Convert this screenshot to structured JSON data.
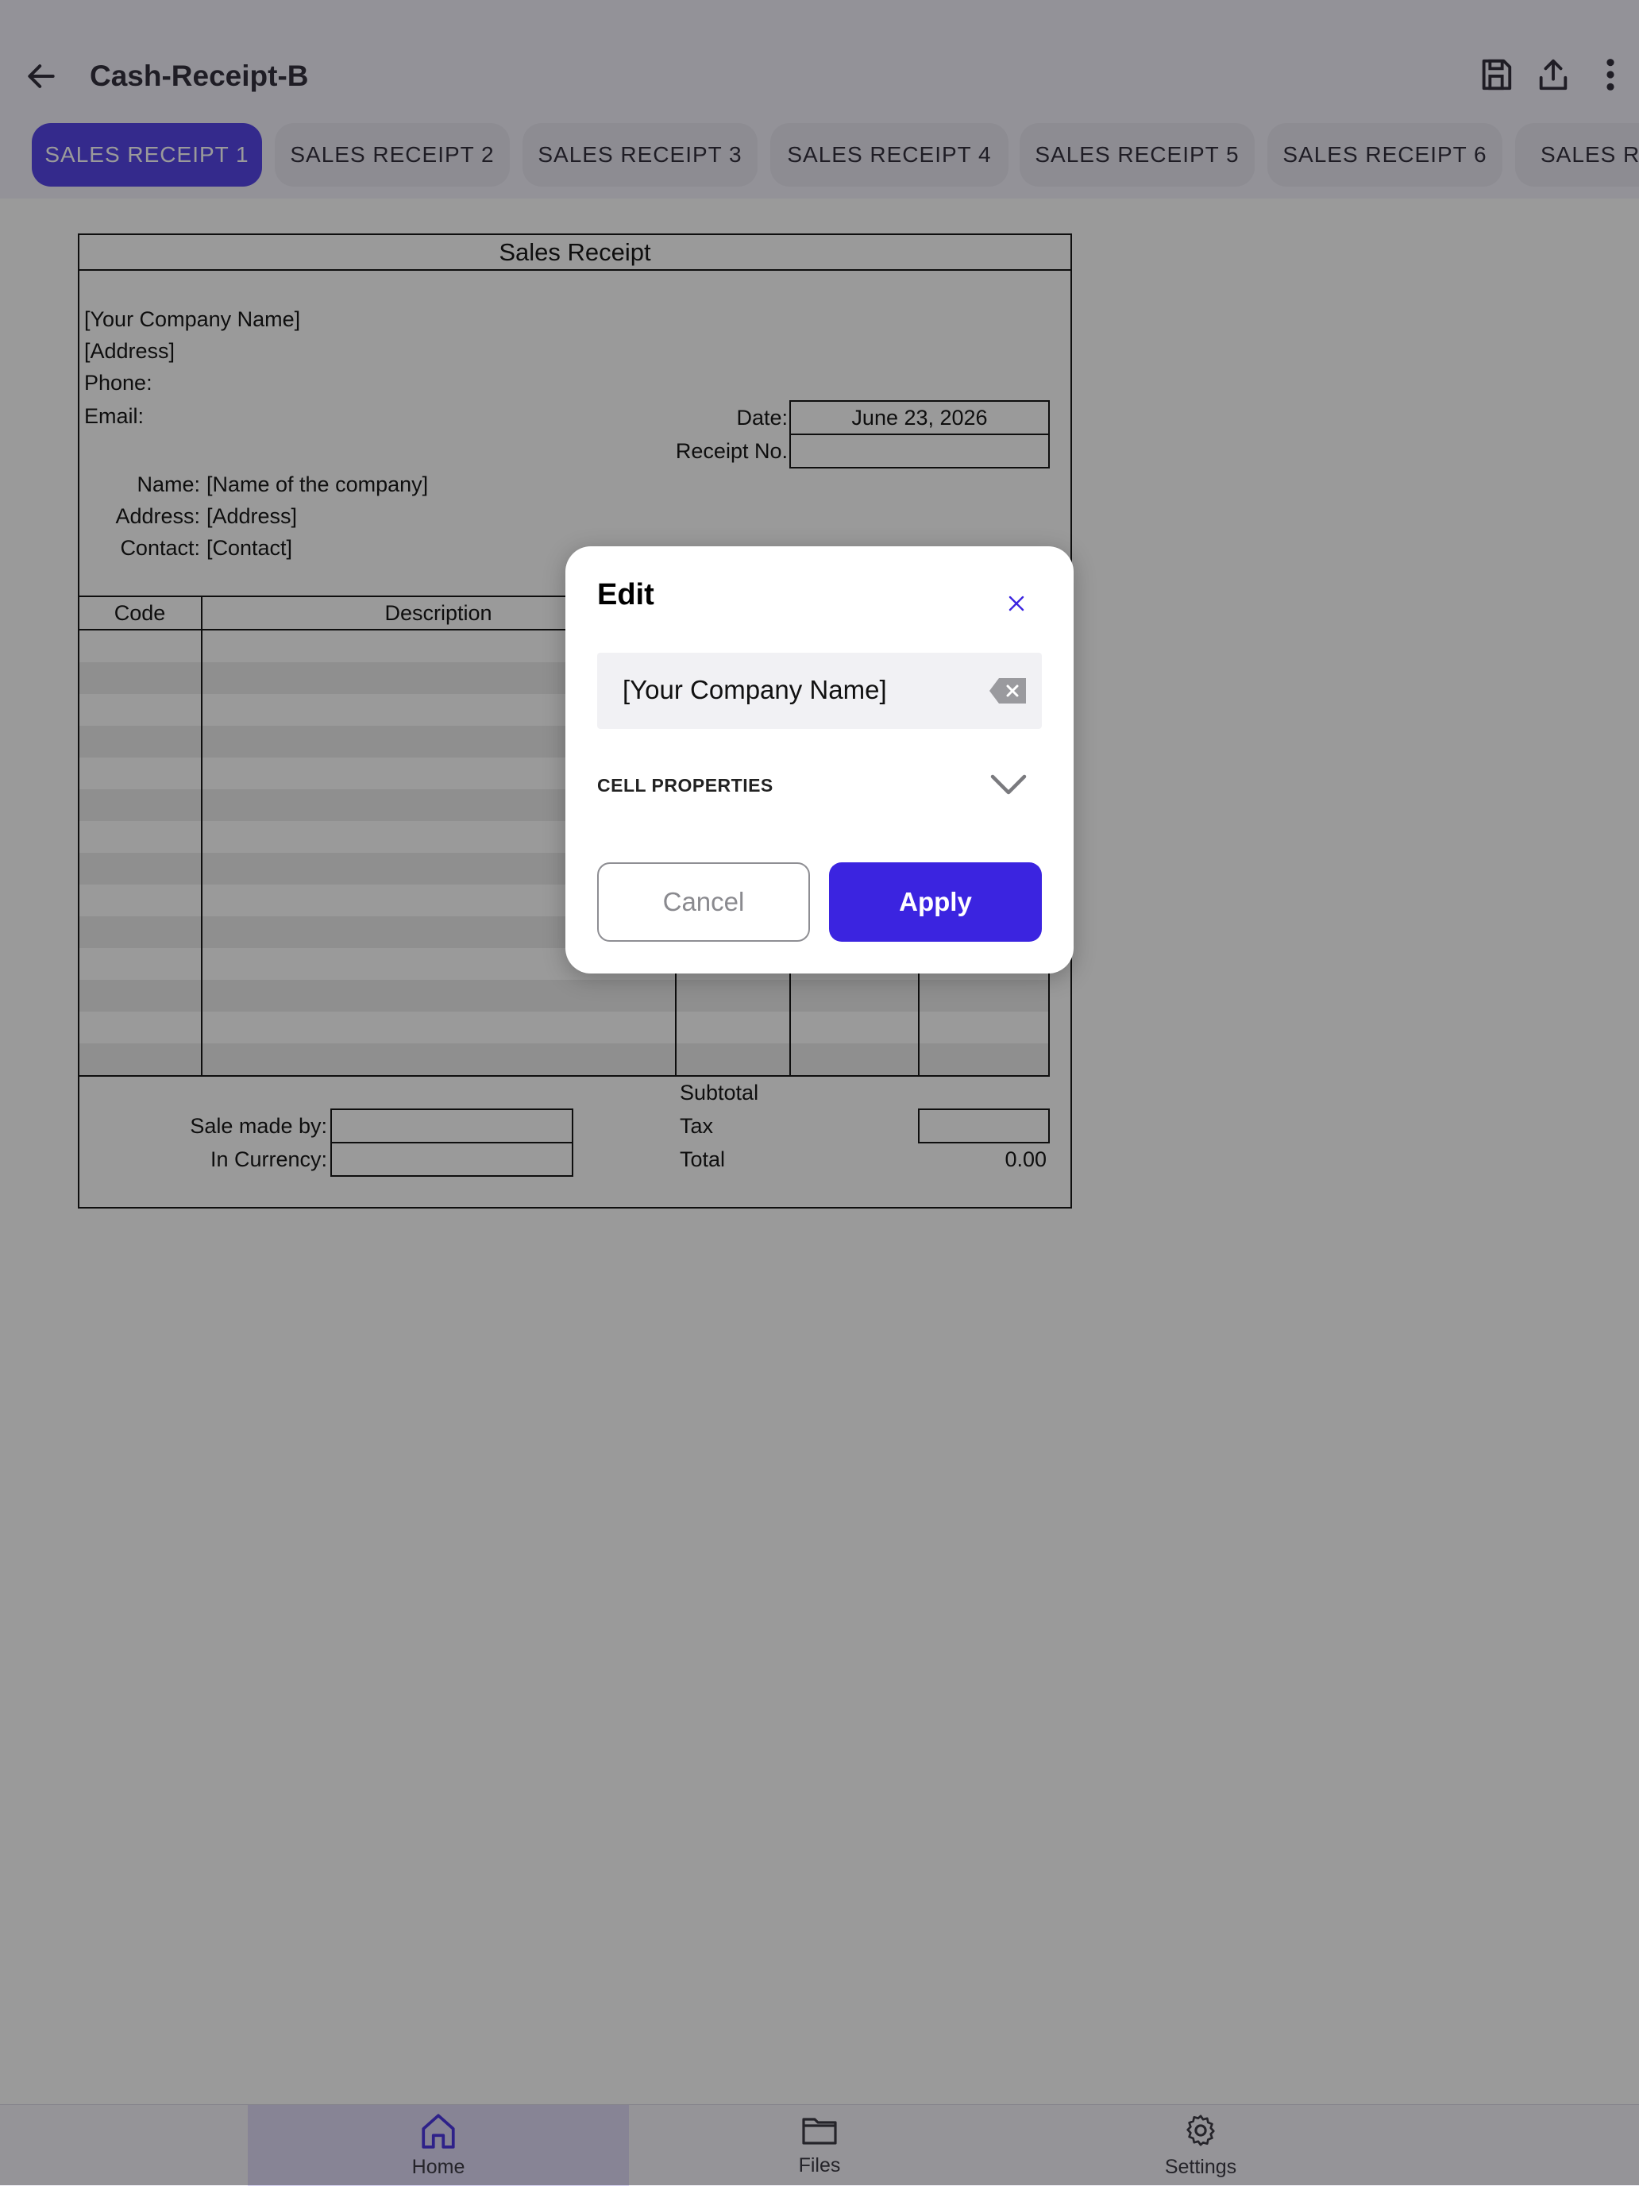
{
  "app_bar": {
    "title": "Cash-Receipt-B",
    "icons": [
      "back-arrow-icon",
      "save-icon",
      "share-icon",
      "more-vert-icon"
    ]
  },
  "tabs": [
    {
      "label": "SALES RECEIPT 1",
      "active": true
    },
    {
      "label": "SALES RECEIPT 2"
    },
    {
      "label": "SALES RECEIPT 3"
    },
    {
      "label": "SALES RECEIPT 4"
    },
    {
      "label": "SALES RECEIPT 5"
    },
    {
      "label": "SALES RECEIPT 6"
    },
    {
      "label": "SALES RI"
    }
  ],
  "receipt": {
    "title": "Sales Receipt",
    "company_name": "[Your Company Name]",
    "address": "[Address]",
    "phone_label": "Phone:",
    "email_label": "Email:",
    "date_label": "Date:",
    "date_value": "June 23, 2026",
    "receipt_no_label": "Receipt No.",
    "receipt_no_value": "",
    "name_label": "Name:",
    "name_value": "[Name of the company]",
    "cust_address_label": "Address:",
    "cust_address_value": "[Address]",
    "contact_label": "Contact:",
    "contact_value": "[Contact]",
    "columns": [
      "Code",
      "Description"
    ],
    "subtotal_label": "Subtotal",
    "tax_label": "Tax",
    "total_label": "Total",
    "total_value": "0.00",
    "sale_made_by_label": "Sale made by:",
    "in_currency_label": "In Currency:"
  },
  "dialog": {
    "title": "Edit",
    "input_value": "[Your Company Name]",
    "section_label": "CELL PROPERTIES",
    "cancel_label": "Cancel",
    "apply_label": "Apply"
  },
  "bottom_nav": [
    {
      "label": "Home",
      "icon": "home-icon",
      "active": true
    },
    {
      "label": "Files",
      "icon": "folder-icon"
    },
    {
      "label": "Settings",
      "icon": "gear-icon"
    }
  ],
  "colors": {
    "accent": "#3b24e0",
    "tab_active": "#4633e6"
  }
}
